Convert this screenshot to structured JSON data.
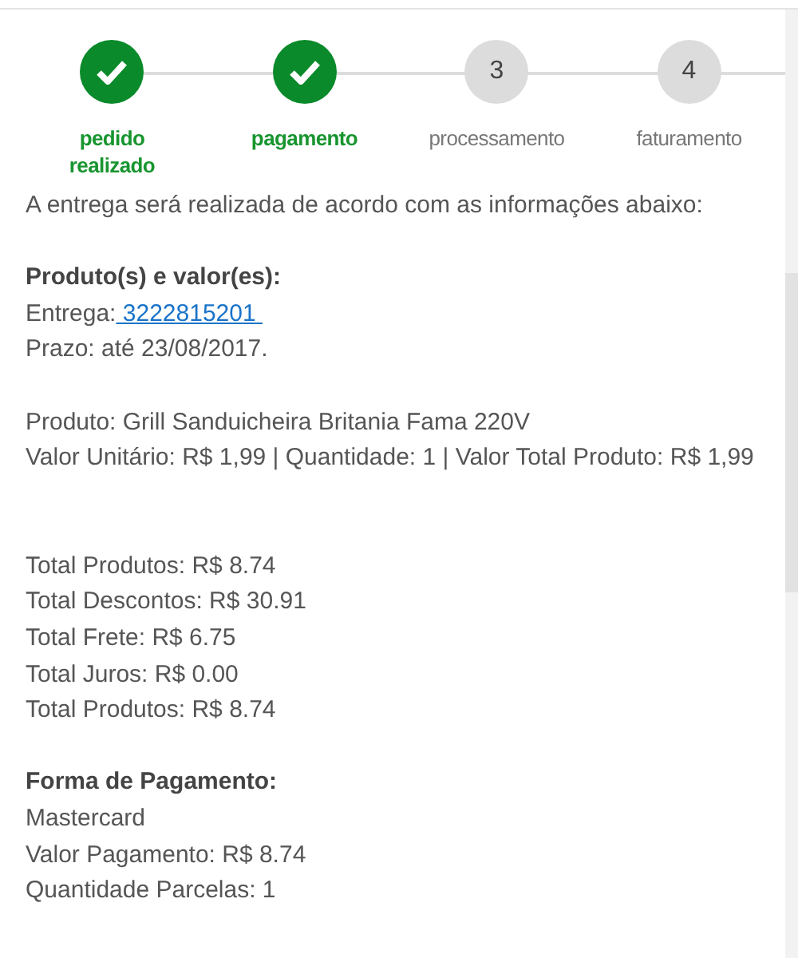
{
  "steps": [
    {
      "label": "pedido realizado",
      "done": true
    },
    {
      "label": "pagamento",
      "done": true
    },
    {
      "number": "3",
      "label": "processamento",
      "done": false
    },
    {
      "number": "4",
      "label": "faturamento",
      "done": false
    }
  ],
  "sections": [
    {
      "kind": "intro",
      "lines": [
        {
          "text": "A entrega será realizada de acordo com as informações abaixo:"
        }
      ]
    },
    {
      "kind": "products",
      "heading": "Produto(s) e valor(es):",
      "lines": [
        {
          "text": "Entrega:",
          "link": " 3222815201 "
        },
        {
          "text": "Prazo: até 23/08/2017."
        }
      ]
    },
    {
      "kind": "item",
      "lines": [
        {
          "text": "Produto: Grill Sanduicheira Britania Fama 220V"
        },
        {
          "text": "Valor Unitário: R$ 1,99 | Quantidade: 1 | Valor Total Produto: R$ 1,99"
        }
      ]
    },
    {
      "kind": "totals",
      "lines": [
        {
          "text": "Total Produtos: R$ 8.74"
        },
        {
          "text": "Total Descontos: R$ 30.91"
        },
        {
          "text": "Total Frete: R$ 6.75"
        },
        {
          "text": "Total Juros: R$ 0.00"
        },
        {
          "text": "Total Produtos: R$ 8.74"
        }
      ]
    },
    {
      "kind": "payment",
      "heading": "Forma de Pagamento:",
      "lines": [
        {
          "text": "Mastercard"
        },
        {
          "text": "Valor Pagamento: R$ 8.74"
        },
        {
          "text": "Quantidade Parcelas: 1"
        }
      ]
    }
  ]
}
